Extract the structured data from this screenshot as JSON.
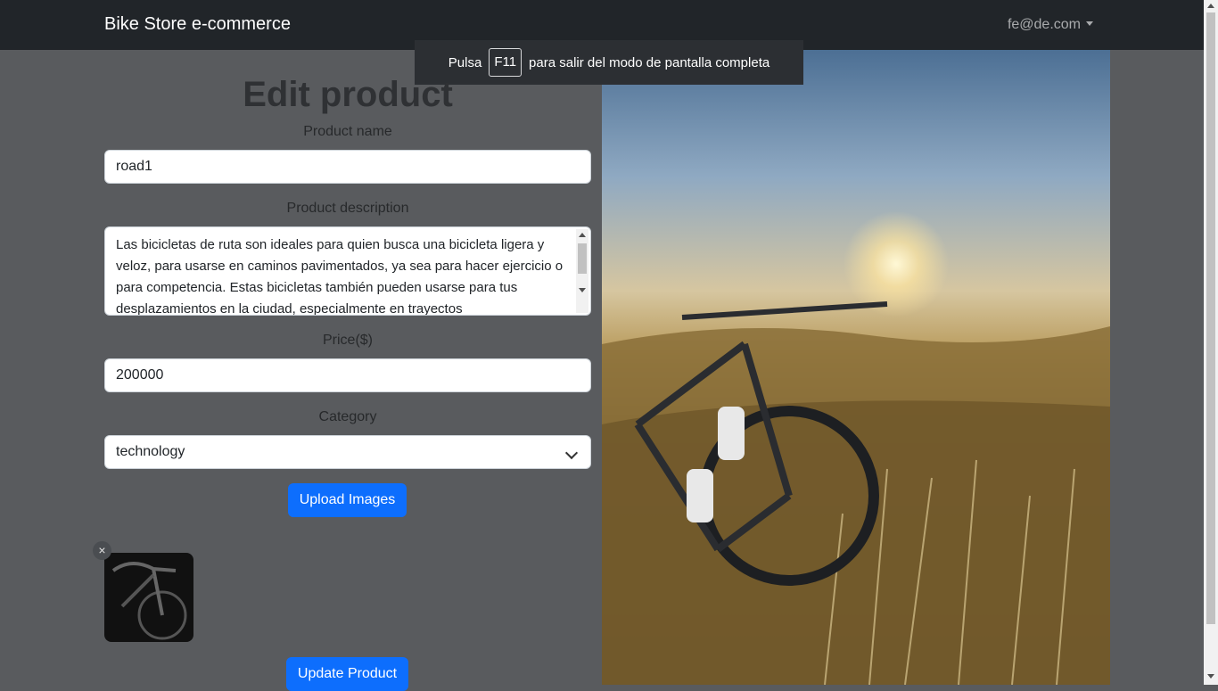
{
  "navbar": {
    "brand": "Bike Store e-commerce",
    "user_email": "fe@de.com"
  },
  "fullscreen_toast": {
    "prefix": "Pulsa",
    "key": "F11",
    "suffix": "para salir del modo de pantalla completa"
  },
  "form": {
    "title": "Edit product",
    "name_label": "Product name",
    "name_value": "road1",
    "description_label": "Product description",
    "description_value": "Las bicicletas de ruta son ideales para quien busca una bicicleta ligera y veloz, para usarse en caminos pavimentados, ya sea para hacer ejercicio o para competencia. Estas bicicletas también pueden usarse para tus desplazamientos en la ciudad, especialmente en trayectos",
    "price_label": "Price($)",
    "price_value": "200000",
    "category_label": "Category",
    "category_value": "technology",
    "upload_label": "Upload Images",
    "remove_icon": "×",
    "update_label": "Update Product"
  },
  "colors": {
    "primary": "#0d6efd",
    "navbar": "#212529",
    "overlay_bg": "#595b5e"
  }
}
